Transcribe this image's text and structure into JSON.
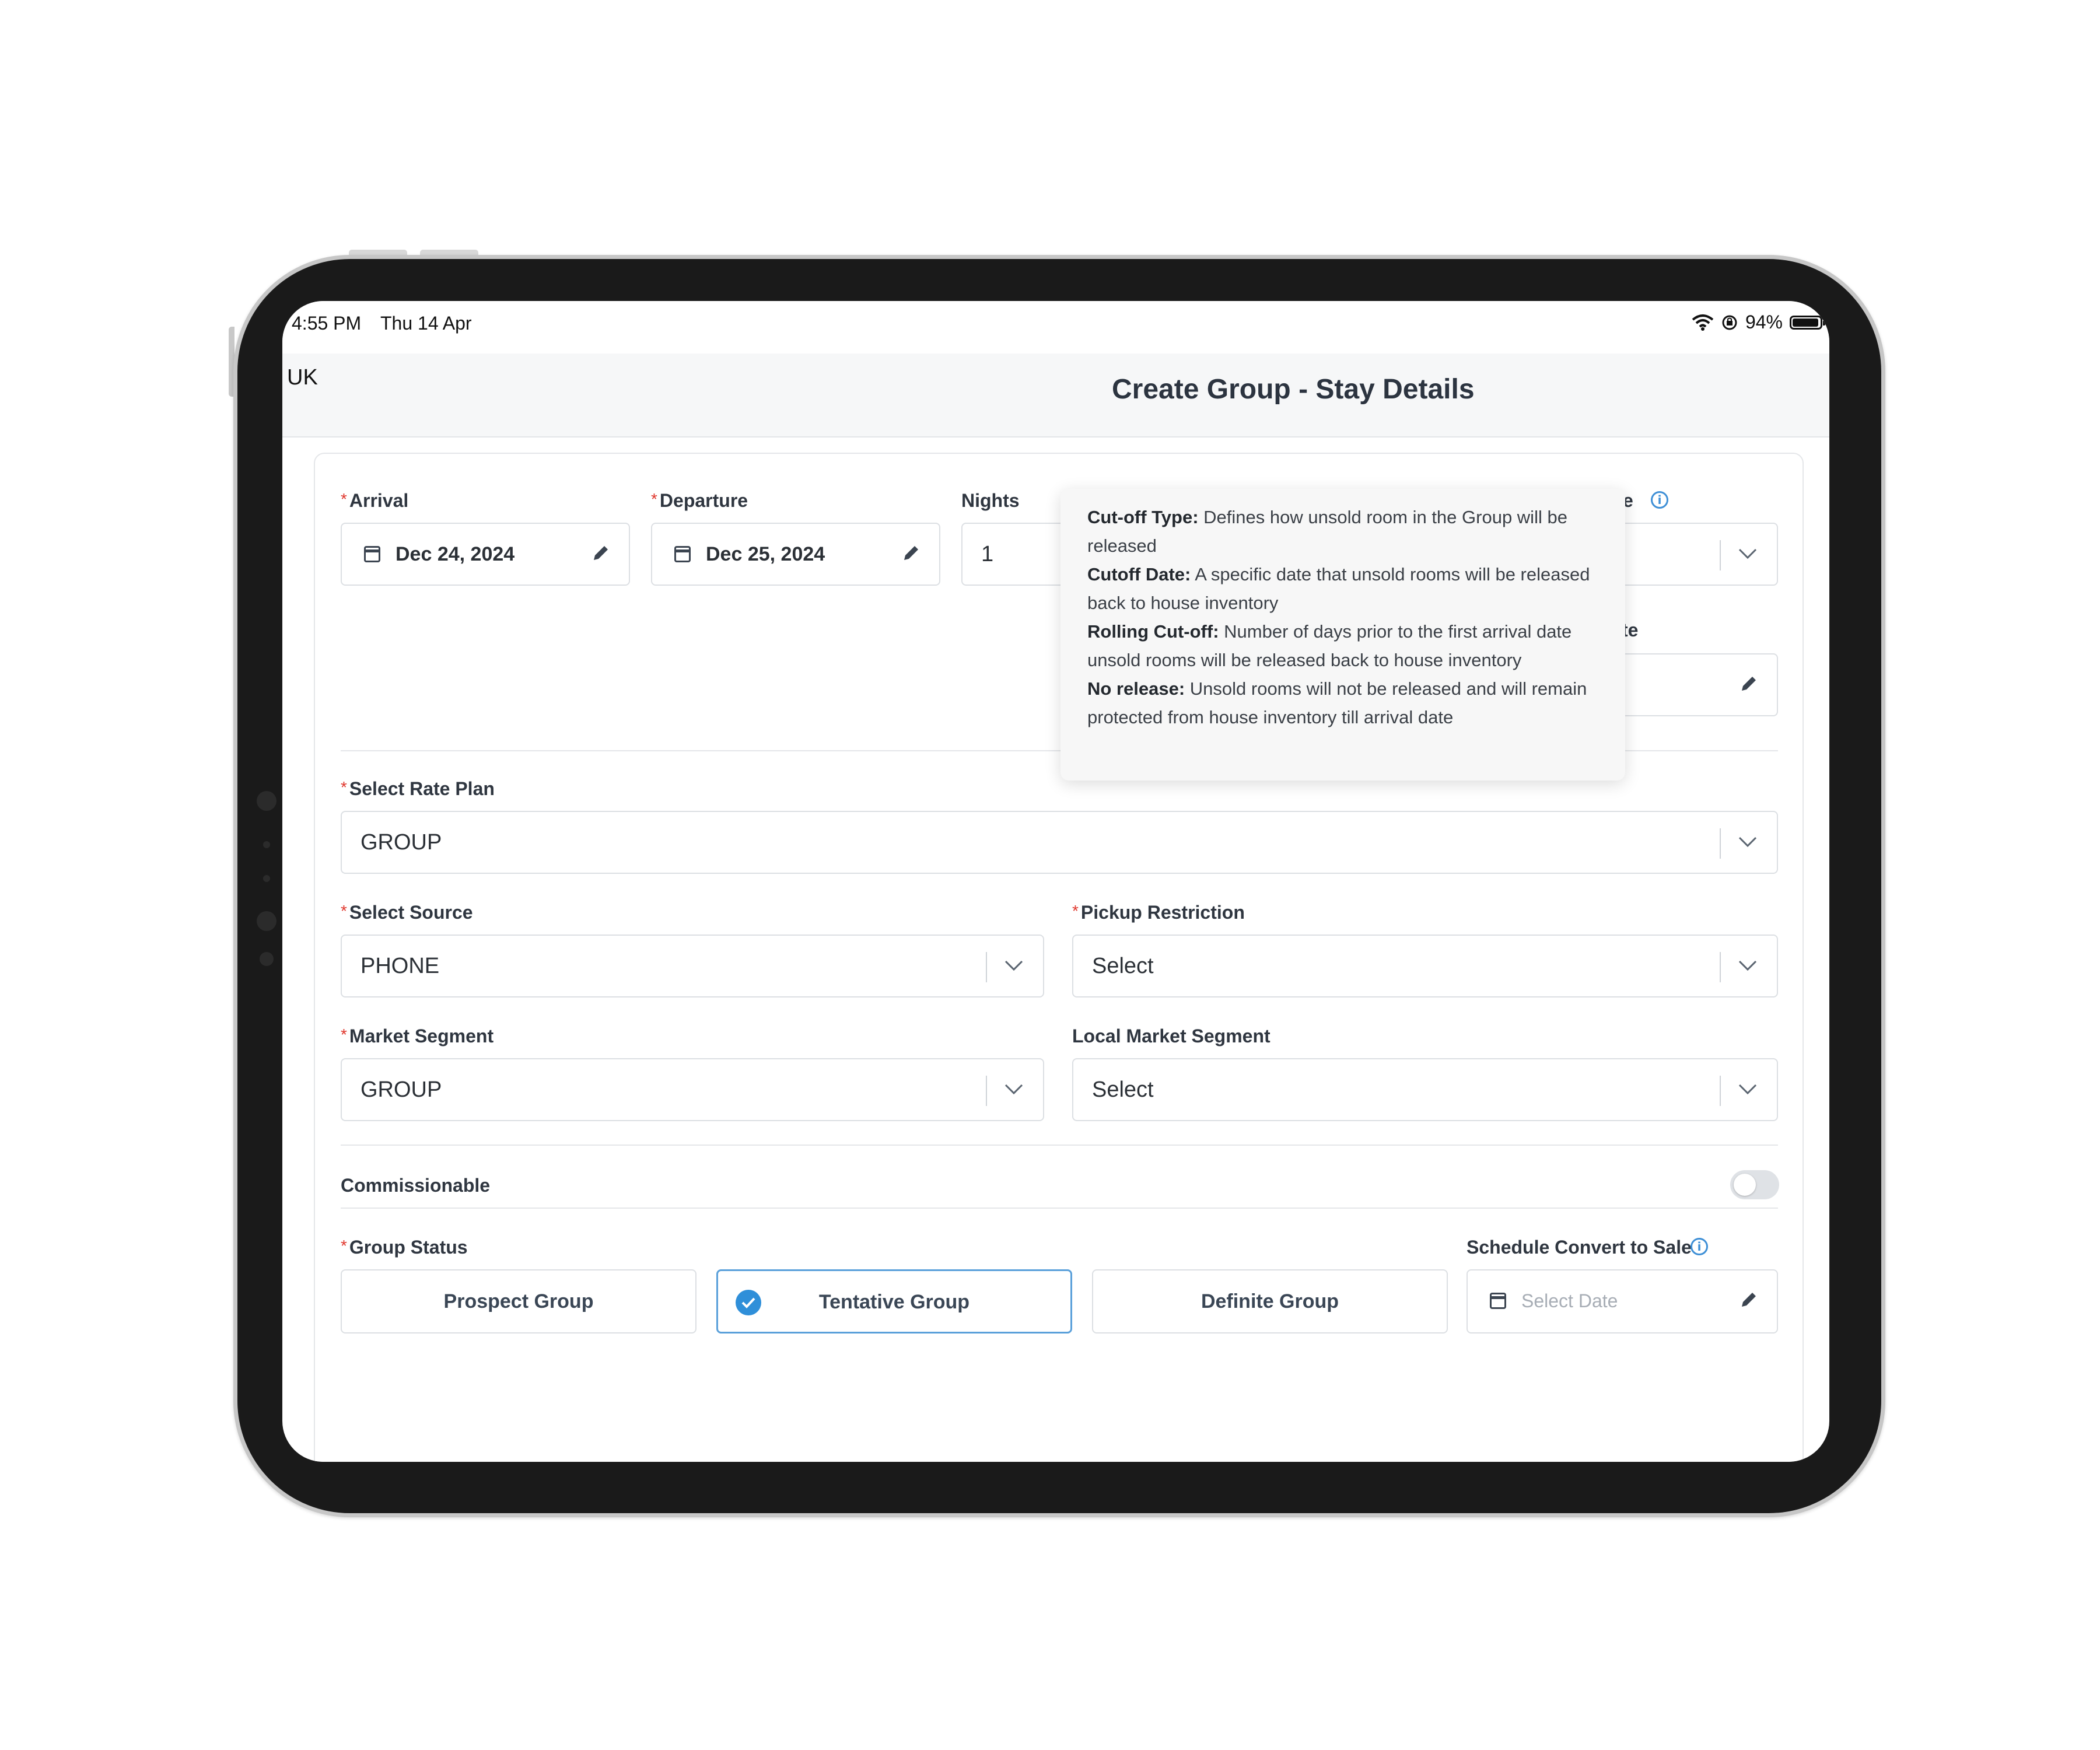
{
  "status_bar": {
    "time": "4:55 PM",
    "date": "Thu 14 Apr",
    "battery": "94%"
  },
  "header": {
    "region": "UK",
    "title": "Create Group - Stay Details"
  },
  "fields": {
    "arrival": {
      "label": "Arrival",
      "value": "Dec 24, 2024"
    },
    "departure": {
      "label": "Departure",
      "value": "Dec 25, 2024"
    },
    "nights": {
      "label": "Nights",
      "value": "1"
    },
    "cutoff_type": {
      "label_fragment": "e"
    },
    "cutoff_date": {
      "label_fragment": "te"
    },
    "rate_plan": {
      "label": "Select Rate Plan",
      "value": "GROUP"
    },
    "source": {
      "label": "Select Source",
      "value": "PHONE"
    },
    "pickup_restriction": {
      "label": "Pickup Restriction",
      "value": "Select"
    },
    "market_segment": {
      "label": "Market Segment",
      "value": "GROUP"
    },
    "local_market_segment": {
      "label": "Local Market Segment",
      "value": "Select"
    },
    "commissionable": {
      "label": "Commissionable",
      "enabled": false
    },
    "group_status": {
      "label": "Group Status",
      "options": [
        "Prospect Group",
        "Tentative Group",
        "Definite Group"
      ],
      "selected": "Tentative Group"
    },
    "schedule_convert": {
      "label": "Schedule Convert to Sale",
      "placeholder": "Select Date"
    }
  },
  "tooltip": {
    "items": [
      {
        "term": "Cut-off Type:",
        "text": "Defines how unsold room in the Group will be released"
      },
      {
        "term": "Cutoff Date:",
        "text": "A specific date that unsold rooms will be released back to house inventory"
      },
      {
        "term": "Rolling Cut-off:",
        "text": "Number of days prior to the first arrival date unsold rooms will be released back to house inventory"
      },
      {
        "term": "No release:",
        "text": "Unsold rooms will not be released and will remain protected from house inventory till arrival date"
      }
    ]
  },
  "icons": [
    "wifi-icon",
    "orientation-lock-icon",
    "battery-icon",
    "calendar-icon",
    "pencil-icon",
    "chevron-down-icon",
    "info-icon",
    "check-circle-icon"
  ],
  "colors": {
    "accent": "#2f8fd9",
    "required": "#e0362c",
    "header_bg": "#f6f7f8"
  }
}
